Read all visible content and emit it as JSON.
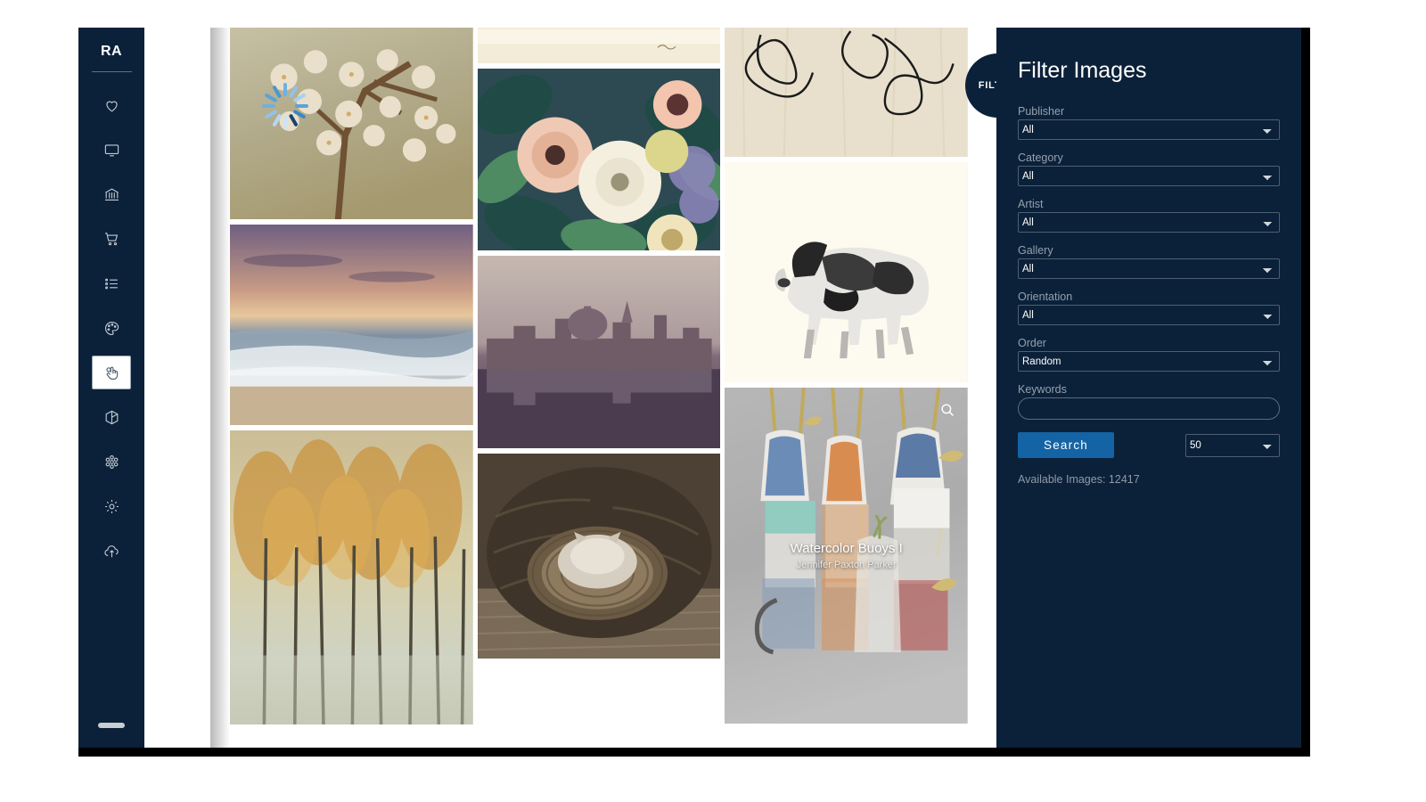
{
  "app": {
    "brand": "RA"
  },
  "sidebar": {
    "items": [
      {
        "name": "favorites",
        "icon": "heart-icon",
        "label": "Favorites",
        "active": false
      },
      {
        "name": "display",
        "icon": "monitor-icon",
        "label": "Display",
        "active": false
      },
      {
        "name": "museum",
        "icon": "bank-icon",
        "label": "Museum",
        "active": false
      },
      {
        "name": "cart",
        "icon": "cart-icon",
        "label": "Cart",
        "active": false
      },
      {
        "name": "list",
        "icon": "list-icon",
        "label": "List",
        "active": false
      },
      {
        "name": "palette",
        "icon": "palette-icon",
        "label": "Palette",
        "active": false
      },
      {
        "name": "select",
        "icon": "hand-click-icon",
        "label": "Select",
        "active": true
      },
      {
        "name": "package",
        "icon": "cube-icon",
        "label": "Package",
        "active": false
      },
      {
        "name": "molecule",
        "icon": "atom-icon",
        "label": "Molecule",
        "active": false
      },
      {
        "name": "settings",
        "icon": "gear-icon",
        "label": "Settings",
        "active": false
      },
      {
        "name": "upload",
        "icon": "cloud-upload-icon",
        "label": "Upload",
        "active": false
      }
    ],
    "drag_handle": "sidebar-resize-handle"
  },
  "filter_toggle": {
    "label": "FILTER",
    "icon": "filter-toggle-button"
  },
  "filter_panel": {
    "heading": "Filter Images",
    "fields": [
      {
        "name": "publisher",
        "label": "Publisher",
        "value": "All",
        "options": [
          "All"
        ]
      },
      {
        "name": "category",
        "label": "Category",
        "value": "All",
        "options": [
          "All"
        ]
      },
      {
        "name": "artist",
        "label": "Artist",
        "value": "All",
        "options": [
          "All"
        ]
      },
      {
        "name": "gallery",
        "label": "Gallery",
        "value": "All",
        "options": [
          "All"
        ]
      },
      {
        "name": "orientation",
        "label": "Orientation",
        "value": "All",
        "options": [
          "All"
        ]
      },
      {
        "name": "order",
        "label": "Order",
        "value": "Random",
        "options": [
          "Random"
        ]
      }
    ],
    "keywords": {
      "label": "Keywords",
      "value": "",
      "placeholder": ""
    },
    "search_button": "Search",
    "page_size": {
      "value": "50",
      "options": [
        "50"
      ]
    },
    "available_images": "Available Images: 12417"
  },
  "gallery": {
    "hovered_card": {
      "title": "Watercolor Buoys I",
      "artist": "Jennifer Paxton Parker",
      "zoom_icon": "magnifier-icon"
    },
    "loading_indicator": "loading-spinner"
  },
  "colors": {
    "navy": "#0b2139",
    "accent_blue": "#1464a5",
    "label_gray": "#94a0ad",
    "frame_black": "#000000"
  }
}
